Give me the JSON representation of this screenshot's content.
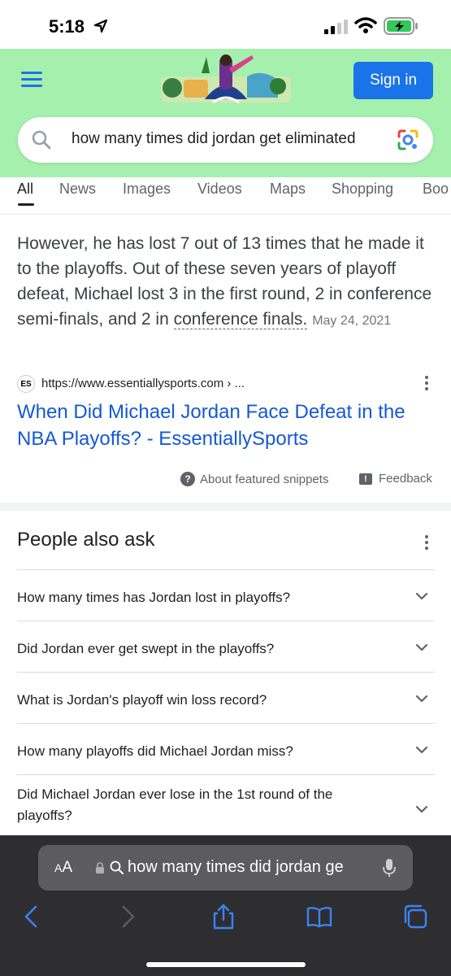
{
  "status_bar": {
    "time": "5:18"
  },
  "header": {
    "signin_label": "Sign in",
    "doodle_icon": "google-doodle-icon"
  },
  "search": {
    "query": "how many times did jordan get eliminated"
  },
  "tabs": [
    {
      "label": "All"
    },
    {
      "label": "News"
    },
    {
      "label": "Images"
    },
    {
      "label": "Videos"
    },
    {
      "label": "Maps"
    },
    {
      "label": "Shopping"
    },
    {
      "label": "Boo"
    }
  ],
  "featured_snippet": {
    "text_main": "However, he has lost 7 out of 13 times that he made it to the playoffs. Out of these seven years of playoff defeat, Michael lost 3 in the first round, 2 in conference semi-finals, and 2 in ",
    "text_tail": "conference finals.",
    "date": "May 24, 2021",
    "favicon_text": "ES",
    "source_url": "https://www.essentiallysports.com › ...",
    "title": "When Did Michael Jordan Face Defeat in the NBA Playoffs? - EssentiallySports",
    "about_label": "About featured snippets",
    "feedback_label": "Feedback"
  },
  "people_also_ask": {
    "title": "People also ask",
    "questions": [
      "How many times has Jordan lost in playoffs?",
      "Did Jordan ever get swept in the playoffs?",
      "What is Jordan's playoff win loss record?",
      "How many playoffs did Michael Jordan miss?",
      "Did Michael Jordan ever lose in the 1st round of the playoffs?"
    ]
  },
  "safari": {
    "aa_big": "A",
    "aa_small": "A",
    "address_text": "how many times did jordan ge"
  },
  "colors": {
    "accent": "#1a73e8",
    "header_green": "#a5f0ad",
    "link": "#1558d6",
    "safari_toolbar": "#2e2e30"
  }
}
